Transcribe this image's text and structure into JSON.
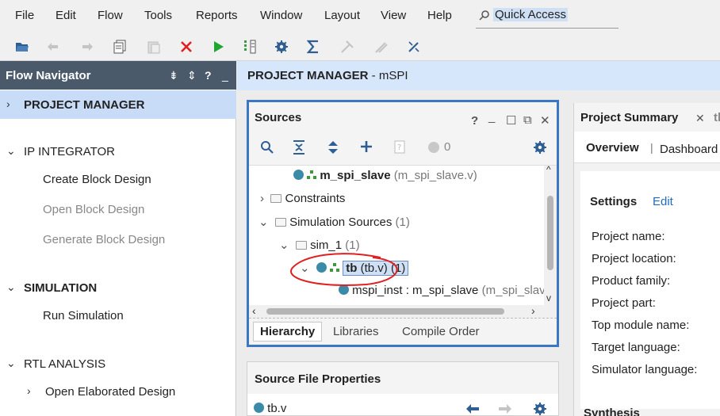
{
  "menu": {
    "items": [
      {
        "label": "File"
      },
      {
        "label": "Edit"
      },
      {
        "label": "Flow"
      },
      {
        "label": "Tools"
      },
      {
        "label": "Reports"
      },
      {
        "label": "Window"
      },
      {
        "label": "Layout"
      },
      {
        "label": "View"
      },
      {
        "label": "Help"
      }
    ],
    "quick_access": "Quick Access"
  },
  "toolbar": {
    "icons": [
      "open-project-icon",
      "undo-icon",
      "redo-icon",
      "copy-icon",
      "paste-icon",
      "delete-icon",
      "run-icon",
      "download-bitstream-icon",
      "settings-icon",
      "sigma-icon",
      "disabled-tool-icon",
      "disabled-tool2-icon",
      "debug-icon"
    ]
  },
  "flow_navigator": {
    "title": "Flow Navigator",
    "sections": [
      {
        "label": "PROJECT MANAGER",
        "selected": true
      },
      {
        "label": "IP INTEGRATOR"
      },
      {
        "label": "Create Block Design"
      },
      {
        "label": "Open Block Design"
      },
      {
        "label": "Generate Block Design"
      },
      {
        "label": "SIMULATION"
      },
      {
        "label": "Run Simulation"
      },
      {
        "label": "RTL ANALYSIS"
      },
      {
        "label": "Open Elaborated Design"
      }
    ]
  },
  "main_header": {
    "title": "PROJECT MANAGER",
    "suffix": " - mSPI"
  },
  "sources": {
    "title": "Sources",
    "count": "0",
    "tree": [
      {
        "name": "m_spi_slave",
        "detail": "(m_spi_slave.v)"
      },
      {
        "name": "Constraints"
      },
      {
        "name": "Simulation Sources",
        "detail": "(1)"
      },
      {
        "name": "sim_1",
        "detail": "(1)"
      },
      {
        "name": "tb",
        "detail": "(tb.v) (1)"
      },
      {
        "name": "mspi_inst : m_spi_slave",
        "detail": "(m_spi_slave.v)"
      }
    ],
    "tabs": [
      {
        "label": "Hierarchy"
      },
      {
        "label": "Libraries"
      },
      {
        "label": "Compile Order"
      }
    ]
  },
  "source_file_properties": {
    "title": "Source File Properties",
    "file": "tb.v"
  },
  "project_summary": {
    "tab": "Project Summary",
    "tab2": "tb",
    "overview": "Overview",
    "dashboard": "Dashboard",
    "settings": "Settings",
    "edit": "Edit",
    "fields": [
      {
        "label": "Project name:"
      },
      {
        "label": "Project location:"
      },
      {
        "label": "Product family:"
      },
      {
        "label": "Project part:"
      },
      {
        "label": "Top module name:"
      },
      {
        "label": "Target language:"
      },
      {
        "label": "Simulator language:"
      }
    ],
    "synthesis": "Synthesis"
  }
}
